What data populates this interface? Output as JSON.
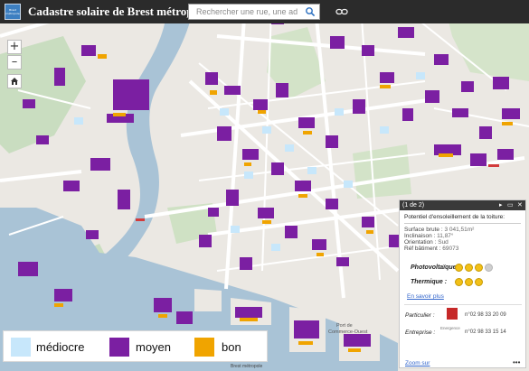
{
  "header": {
    "logo_text": "Brest métropole",
    "title": "Cadastre solaire de Brest métropole",
    "search_placeholder": "Rechercher une rue, une adresse...",
    "search_icon": "search-icon",
    "link_icon": "link-icon"
  },
  "map_controls": {
    "zoom_in": "+",
    "zoom_out": "–",
    "home_icon": "home-icon"
  },
  "map_labels": {
    "port_label_1": "Port de",
    "port_label_2": "Commerce-Ouest"
  },
  "legend": {
    "items": [
      {
        "label": "médiocre",
        "color": "#c7e7fb"
      },
      {
        "label": "moyen",
        "color": "#7b1fa2"
      },
      {
        "label": "bon",
        "color": "#f0a400"
      }
    ]
  },
  "popup": {
    "counter": "(1 de 2)",
    "title": "Potentiel d'ensoleillement de la toiture:",
    "fields": [
      {
        "label": "Surface brute :",
        "value": "3 041,51m²"
      },
      {
        "label": "Inclinaison :",
        "value": "11,87°"
      },
      {
        "label": "Orientation :",
        "value": "Sud"
      },
      {
        "label": "Réf bâtiment :",
        "value": "69073"
      }
    ],
    "photovoltaique_label": "Photovoltaïque :",
    "photovoltaique_rating": 3,
    "photovoltaique_max": 4,
    "thermique_label": "Thermique :",
    "thermique_rating": 3,
    "thermique_max": 3,
    "learn_more": "En savoir plus",
    "particulier_label": "Particulier :",
    "particulier_phone": "n°02 98 33 20 09",
    "entreprise_label": "Entreprise :",
    "entreprise_logo_text": "Energence",
    "entreprise_phone": "n°02 98 33 15 14",
    "zoom_link": "Zoom sur",
    "more": "•••"
  },
  "attribution": "Brest métropole"
}
